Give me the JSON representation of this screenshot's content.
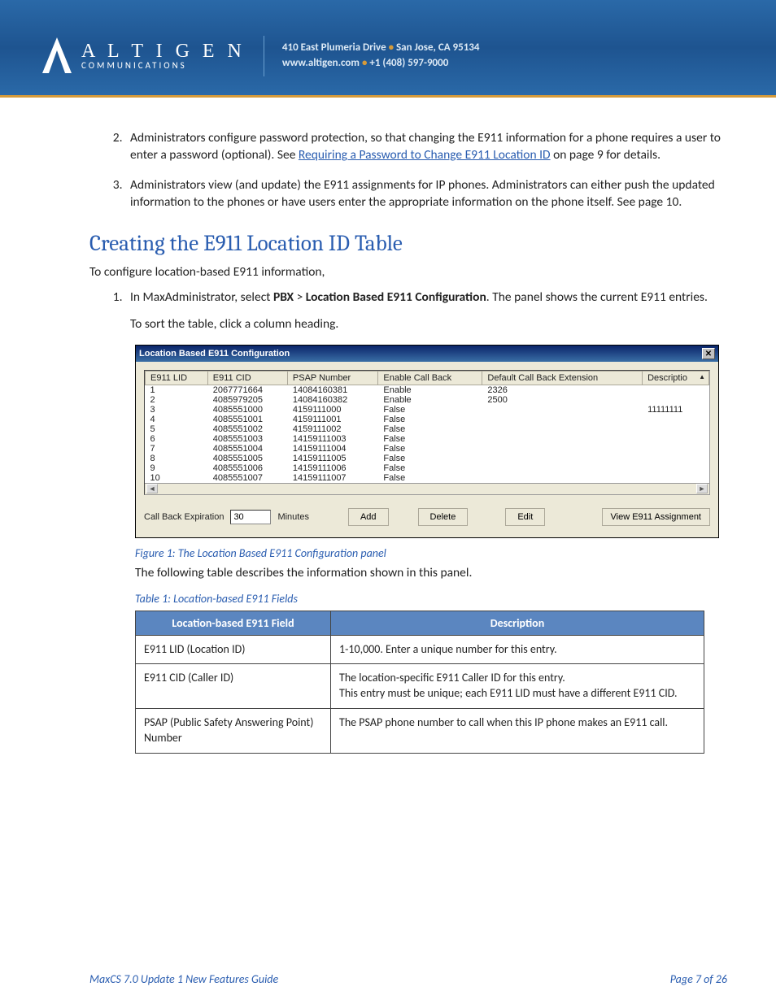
{
  "header": {
    "brand_line1": "A L T I G E N",
    "brand_line2": "COMMUNICATIONS",
    "address_line1_a": "410 East Plumeria Drive",
    "address_line1_b": "San Jose, CA 95134",
    "address_line2_a": "www.altigen.com",
    "address_line2_b": "+1 (408) 597-9000"
  },
  "list_items": {
    "item2_a": "Administrators configure password protection, so that changing the E911 information for a phone requires a user to enter a password (optional). See ",
    "item2_link": "Requiring a Password to Change E911 Location ID",
    "item2_b": " on page 9 for details.",
    "item3": "Administrators view (and update) the E911 assignments for IP phones. Administrators can either push the updated information to the phones or have users enter the appropriate information on the phone itself. See page 10."
  },
  "section_heading": "Creating the E911 Location ID Table",
  "intro_text": "To configure location-based E911 information,",
  "step1_a": "In MaxAdministrator, select ",
  "step1_bold1": "PBX",
  "step1_gt": " > ",
  "step1_bold2": "Location Based E911 Configuration",
  "step1_b": ".  The panel shows the current E911 entries.",
  "step1_sub": "To sort the table, click a column heading.",
  "screenshot": {
    "title": "Location Based E911 Configuration",
    "columns": [
      "E911 LID",
      "E911 CID",
      "PSAP Number",
      "Enable Call Back",
      "Default Call Back Extension",
      "Descriptio"
    ],
    "rows": [
      [
        "1",
        "2067771664",
        "14084160381",
        "Enable",
        "2326",
        ""
      ],
      [
        "2",
        "4085979205",
        "14084160382",
        "Enable",
        "2500",
        ""
      ],
      [
        "3",
        "4085551000",
        "4159111000",
        "False",
        "",
        "11111111"
      ],
      [
        "4",
        "4085551001",
        "4159111001",
        "False",
        "",
        ""
      ],
      [
        "5",
        "4085551002",
        "4159111002",
        "False",
        "",
        ""
      ],
      [
        "6",
        "4085551003",
        "14159111003",
        "False",
        "",
        ""
      ],
      [
        "7",
        "4085551004",
        "14159111004",
        "False",
        "",
        ""
      ],
      [
        "8",
        "4085551005",
        "14159111005",
        "False",
        "",
        ""
      ],
      [
        "9",
        "4085551006",
        "14159111006",
        "False",
        "",
        ""
      ],
      [
        "10",
        "4085551007",
        "14159111007",
        "False",
        "",
        ""
      ]
    ],
    "callback_label": "Call Back Expiration",
    "callback_value": "30",
    "callback_unit": "Minutes",
    "btn_add": "Add",
    "btn_delete": "Delete",
    "btn_edit": "Edit",
    "btn_view": "View E911 Assignment"
  },
  "figure_caption": "Figure 1: The Location Based E911 Configuration panel",
  "after_figure": "The following table describes the information shown in this panel.",
  "table_caption": "Table 1: Location-based E911 Fields",
  "desc_table": {
    "headers": [
      "Location-based E911 Field",
      "Description"
    ],
    "rows": [
      [
        "E911 LID (Location ID)",
        "1-10,000. Enter a unique number for this entry."
      ],
      [
        "E911 CID (Caller ID)",
        "The location-specific E911 Caller ID for this entry.\nThis entry must be unique; each E911 LID must have a different E911 CID."
      ],
      [
        "PSAP (Public Safety Answering Point) Number",
        "The PSAP phone number to call when this IP phone makes an E911 call."
      ]
    ]
  },
  "footer": {
    "left": "MaxCS 7.0 Update 1 New Features Guide",
    "right": "Page 7 of 26"
  }
}
